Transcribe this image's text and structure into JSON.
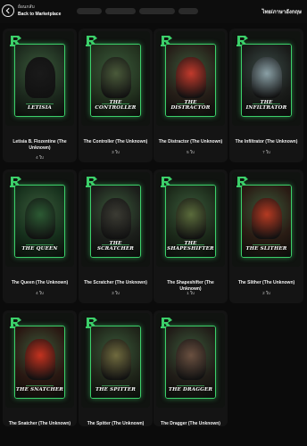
{
  "header": {
    "back_small": "ย้อนกลับ",
    "back_label": "Back to Marketplace",
    "lang_label": "ไทย/ภาษาอังกฤษ"
  },
  "colors": {
    "accent": "#3cd06a",
    "background": "#0b0b0b",
    "card": "#141414"
  },
  "cards": [
    {
      "art_title": "LETISIA",
      "name": "Letisia B. Flozentine (The Unknown)",
      "count": "4 ใบ",
      "theme": "#1d2a1e",
      "subject": "#1a1a1a"
    },
    {
      "art_title": "THE CONTROLLER",
      "name": "The Controller (The Unknown)",
      "count": "3 ใบ",
      "theme": "#23321f",
      "subject": "#4a5a3a"
    },
    {
      "art_title": "THE DISTRACTOR",
      "name": "The Distractor (The Unknown)",
      "count": "5 ใบ",
      "theme": "#261e18",
      "subject": "#c23a2c"
    },
    {
      "art_title": "THE INFILTRATOR",
      "name": "The Infiltrator (The Unknown)",
      "count": "7 ใบ",
      "theme": "#1a1c1a",
      "subject": "#8aa0a6"
    },
    {
      "art_title": "THE QUEEN",
      "name": "The Queen (The Unknown)",
      "count": "4 ใบ",
      "theme": "#16301c",
      "subject": "#2c5a33"
    },
    {
      "art_title": "THE SCRATCHER",
      "name": "The Scratcher (The Unknown)",
      "count": "3 ใบ",
      "theme": "#1c1f1b",
      "subject": "#3b3b33"
    },
    {
      "art_title": "THE SHAPESHIFTER",
      "name": "The Shapeshifter (The Unknown)",
      "count": "1 ใบ",
      "theme": "#1c2a1a",
      "subject": "#5a6b3b"
    },
    {
      "art_title": "THE SLITHER",
      "name": "The Slither (The Unknown)",
      "count": "2 ใบ",
      "theme": "#2a1c14",
      "subject": "#b53a22"
    },
    {
      "art_title": "THE SNATCHER",
      "name": "The Snatcher (The Unknown)",
      "count": "3 ใบ",
      "theme": "#2a1812",
      "subject": "#c4321f"
    },
    {
      "art_title": "THE SPITTER",
      "name": "The Spitter (The Unknown)",
      "count": "2 ใบ",
      "theme": "#20261a",
      "subject": "#6f6a3e"
    },
    {
      "art_title": "THE DRAGGER",
      "name": "The Dragger (The Unknown)",
      "count": "4 ใบ",
      "theme": "#211d18",
      "subject": "#6a5040"
    }
  ]
}
